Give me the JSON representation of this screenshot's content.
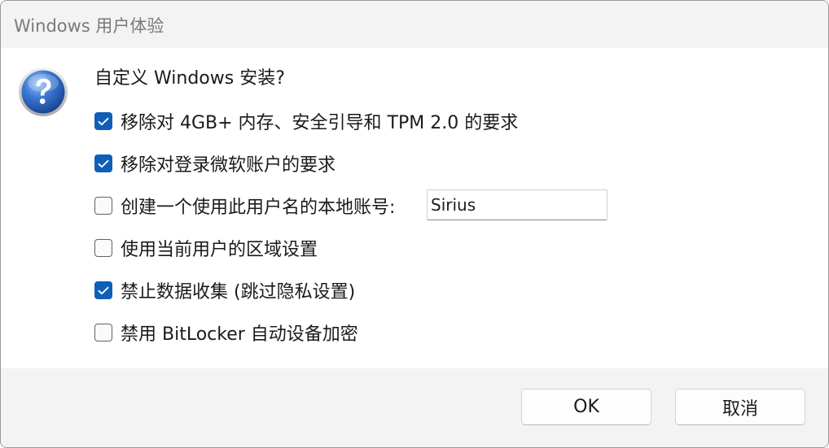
{
  "window": {
    "title": "Windows 用户体验"
  },
  "dialog": {
    "icon": "question-mark-icon",
    "question": "自定义 Windows 安装?",
    "options": [
      {
        "label": "移除对 4GB+ 内存、安全引导和 TPM 2.0 的要求",
        "checked": true
      },
      {
        "label": "移除对登录微软账户的要求",
        "checked": true
      },
      {
        "label": "创建一个使用此用户名的本地账号:",
        "checked": false
      },
      {
        "label": "使用当前用户的区域设置",
        "checked": false
      },
      {
        "label": "禁止数据收集 (跳过隐私设置)",
        "checked": true
      },
      {
        "label": "禁用 BitLocker 自动设备加密",
        "checked": false
      }
    ],
    "username_value": "Sirius"
  },
  "buttons": {
    "ok_label": "OK",
    "cancel_label": "取消"
  },
  "colors": {
    "accent": "#0f5fb8",
    "titlebar_bg": "#f3f3f3",
    "footer_bg": "#f3f3f3"
  }
}
